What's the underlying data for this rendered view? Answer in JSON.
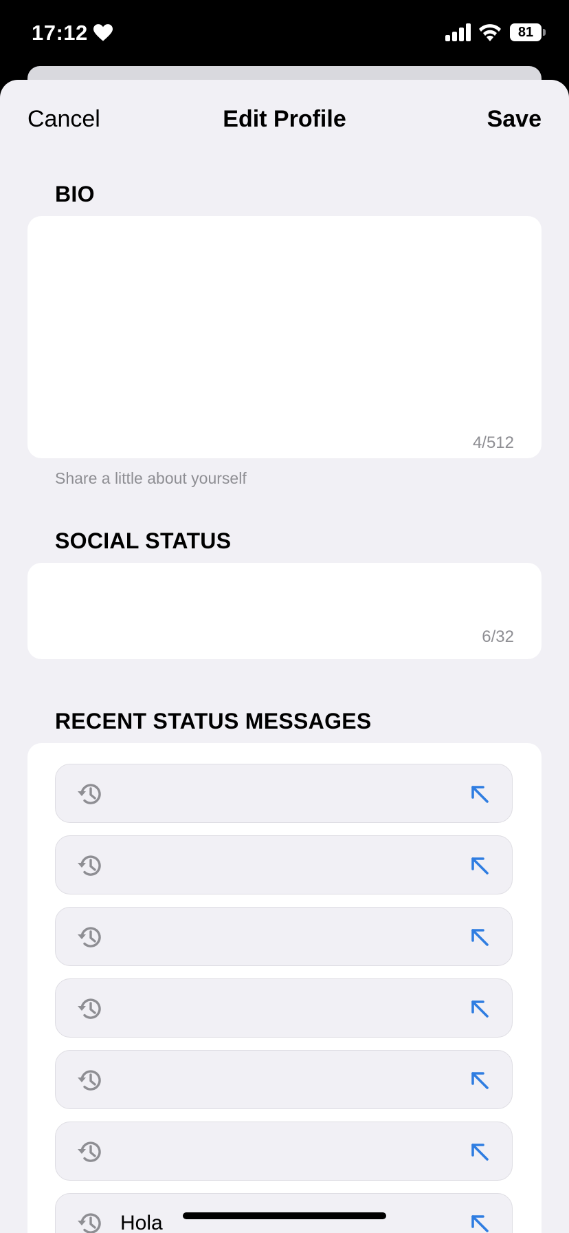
{
  "status_bar": {
    "time": "17:12",
    "battery": "81",
    "icons": [
      "heart-icon",
      "signal-icon",
      "wifi-icon",
      "battery-icon"
    ]
  },
  "nav": {
    "cancel_label": "Cancel",
    "title": "Edit Profile",
    "save_label": "Save"
  },
  "bio": {
    "header": "BIO",
    "value": "",
    "counter": "4/512",
    "hint": "Share a little about yourself"
  },
  "social_status": {
    "header": "SOCIAL STATUS",
    "value": "",
    "counter": "6/32"
  },
  "recent": {
    "header": "RECENT STATUS MESSAGES",
    "items": [
      {
        "text": ""
      },
      {
        "text": ""
      },
      {
        "text": ""
      },
      {
        "text": ""
      },
      {
        "text": ""
      },
      {
        "text": ""
      },
      {
        "text": "Hola"
      }
    ],
    "row_icon": "history-icon",
    "action_icon": "arrow-up-left-icon"
  },
  "colors": {
    "sheet_background": "#f1f0f5",
    "card_background": "#ffffff",
    "secondary_text": "#8e8e93",
    "accent_blue": "#2f7de1",
    "history_gray": "#8e8e93"
  }
}
